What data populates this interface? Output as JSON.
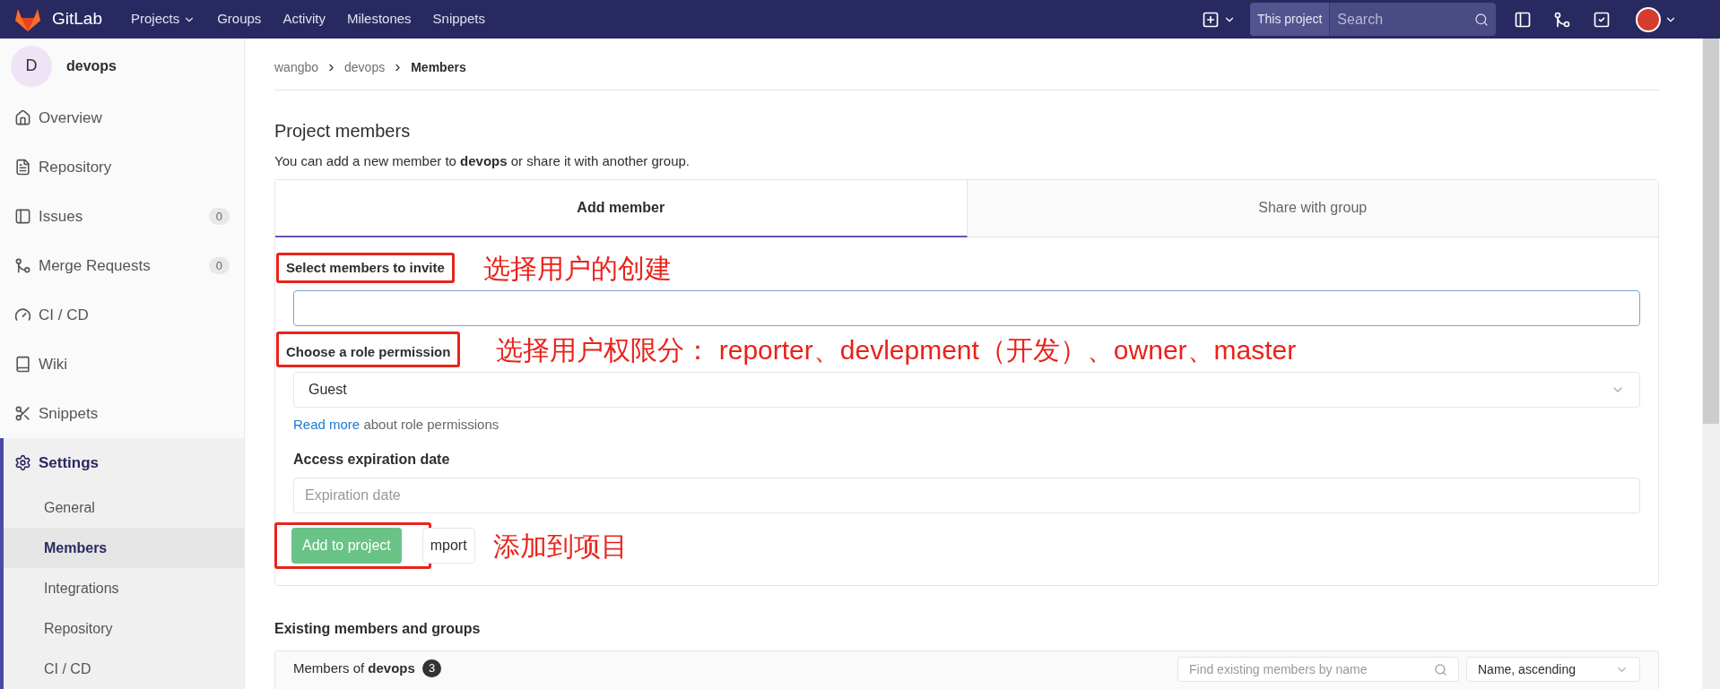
{
  "navbar": {
    "logo": "GitLab",
    "links": [
      {
        "label": "Projects",
        "dropdown": true
      },
      {
        "label": "Groups",
        "dropdown": false
      },
      {
        "label": "Activity",
        "dropdown": false
      },
      {
        "label": "Milestones",
        "dropdown": false
      },
      {
        "label": "Snippets",
        "dropdown": false
      }
    ],
    "scope": "This project",
    "search": {
      "placeholder": "Search"
    }
  },
  "sidebar": {
    "avatar": "D",
    "project": "devops",
    "items": [
      {
        "label": "Overview",
        "selected": false
      },
      {
        "label": "Repository",
        "selected": false
      },
      {
        "label": "Issues",
        "count": "0",
        "selected": false
      },
      {
        "label": "Merge Requests",
        "count": "0",
        "selected": false
      },
      {
        "label": "CI / CD",
        "selected": false
      },
      {
        "label": "Wiki",
        "selected": false
      },
      {
        "label": "Snippets",
        "selected": false
      },
      {
        "label": "Settings",
        "selected": true,
        "children": [
          {
            "label": "General",
            "selected": false
          },
          {
            "label": "Members",
            "selected": true
          },
          {
            "label": "Integrations",
            "selected": false
          },
          {
            "label": "Repository",
            "selected": false
          },
          {
            "label": "CI / CD",
            "selected": false
          }
        ]
      }
    ]
  },
  "breadcrumb": [
    "wangbo",
    "devops",
    "Members"
  ],
  "heading": "Project members",
  "intro": "You can add a new member to **devops** or share it with another group.",
  "tabs": [
    {
      "label": "Add member",
      "selected": true
    },
    {
      "label": "Share with group",
      "selected": false
    }
  ],
  "form": {
    "invite_label": "Select members to invite",
    "invite_note": "选择用户的创建",
    "role_label": "Choose a role permission",
    "role_note": "选择用户权限分： reporter、devlepment（开发）、owner、master",
    "role_value": "Guest",
    "read_more_link": "Read more",
    "read_more_rest": "about role permissions",
    "expiry_label": "Access expiration date",
    "expiry_placeholder": "Expiration date",
    "submit": "Add to project",
    "import": "mport",
    "submit_note": "添加到项目"
  },
  "existing": {
    "title": "Existing members and groups",
    "members_of": "Members of **devops**",
    "count": "3",
    "filter_placeholder": "Find existing members by name",
    "sort": "Name, ascending"
  }
}
